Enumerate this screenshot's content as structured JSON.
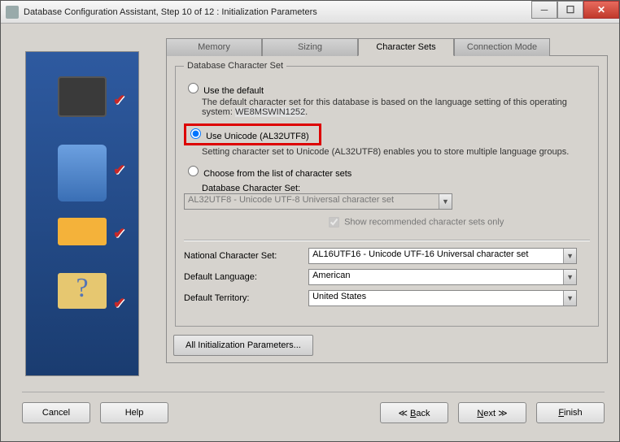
{
  "window": {
    "title": "Database Configuration Assistant, Step 10 of 12 : Initialization Parameters"
  },
  "tabs": {
    "memory": "Memory",
    "sizing": "Sizing",
    "charsets": "Character Sets",
    "connmode": "Connection Mode"
  },
  "fieldset": {
    "legend": "Database Character Set"
  },
  "opt1": {
    "label": "Use the default",
    "desc_a": "The default character set for this database is based on the language setting of this operating system: ",
    "desc_b": "WE8MSWIN1252",
    "desc_c": "."
  },
  "opt2": {
    "label": "Use Unicode (AL32UTF8)",
    "desc": "Setting character set to Unicode (AL32UTF8) enables you to store multiple language groups."
  },
  "opt3": {
    "label": "Choose from the list of character sets",
    "sublabel": "Database Character Set:",
    "value": "AL32UTF8 - Unicode UTF-8 Universal character set",
    "checkbox": "Show recommended character sets only"
  },
  "national": {
    "label": "National Character Set:",
    "value": "AL16UTF16 - Unicode UTF-16 Universal character set"
  },
  "language": {
    "label": "Default Language:",
    "value": "American"
  },
  "territory": {
    "label": "Default Territory:",
    "value": "United States"
  },
  "allparams": "All Initialization Parameters...",
  "footer": {
    "cancel": "Cancel",
    "help": "Help",
    "back_u": "B",
    "back_rest": "ack",
    "next_u": "N",
    "next_rest": "ext",
    "finish_u": "F",
    "finish_rest": "inish"
  }
}
